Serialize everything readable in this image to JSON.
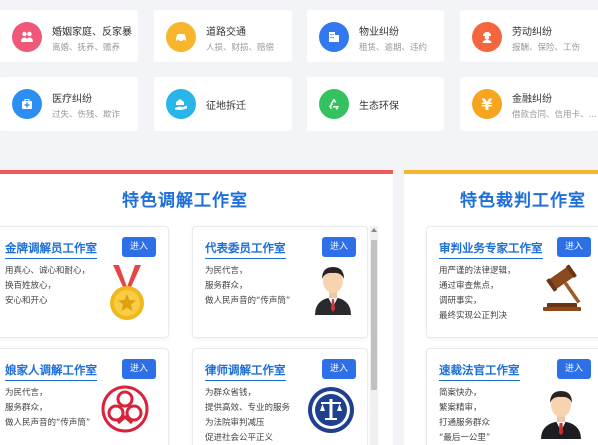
{
  "categories": [
    {
      "title": "婚姻家庭、反家暴",
      "subtitle": "离婚、抚养、赡养",
      "icon": "heart-family-icon",
      "color": "#f0587a"
    },
    {
      "title": "道路交通",
      "subtitle": "人损、财损、赔偿",
      "icon": "car-icon",
      "color": "#f7b52c"
    },
    {
      "title": "物业纠纷",
      "subtitle": "租赁、逾期、违约",
      "icon": "building-icon",
      "color": "#3478f0"
    },
    {
      "title": "劳动纠纷",
      "subtitle": "报酬、保险、工伤",
      "icon": "worker-icon",
      "color": "#f4663e"
    },
    {
      "title": "医疗纠纷",
      "subtitle": "过失、伤残、欺诈",
      "icon": "medical-kit-icon",
      "color": "#2c8ef2"
    },
    {
      "title": "征地拆迁",
      "subtitle": "",
      "icon": "house-hand-icon",
      "color": "#28b6e8"
    },
    {
      "title": "生态环保",
      "subtitle": "",
      "icon": "recycle-icon",
      "color": "#33c25f"
    },
    {
      "title": "金融纠纷",
      "subtitle": "借款合同、信用卡、...",
      "icon": "yen-icon",
      "color": "#f7a51e"
    }
  ],
  "mediation": {
    "title": "特色调解工作室",
    "accent": "#f05a5a",
    "studios": [
      {
        "name": "金牌调解员工作室",
        "button": "进入",
        "lines": [
          "用真心、诚心和耐心，",
          "换百姓放心，",
          "安心和开心"
        ],
        "illustration": "gold-medal-icon"
      },
      {
        "name": "代表委员工作室",
        "button": "进入",
        "lines": [
          "为民代言，",
          "服务群众，",
          "做人民声音的“传声筒”"
        ],
        "illustration": "representative-avatar-icon"
      },
      {
        "name": "娘家人调解工作室",
        "button": "进入",
        "lines": [
          "为民代言，",
          "服务群众，",
          "做人民声音的“传声筒”"
        ],
        "illustration": "women-federation-emblem-icon"
      },
      {
        "name": "律师调解工作室",
        "button": "进入",
        "lines": [
          "为群众省钱，",
          "提供高效、专业的服务",
          "为法院审判减压",
          "促进社会公平正义"
        ],
        "illustration": "lawyers-association-emblem-icon"
      }
    ]
  },
  "adjudication": {
    "title": "特色裁判工作室",
    "accent": "#f7b52c",
    "studios": [
      {
        "name": "审判业务专家工作室",
        "button": "进入",
        "lines": [
          "用严谨的法律逻辑，",
          "通过审查焦点，",
          "调研事实，",
          "最终实现公正判决"
        ],
        "illustration": "gavel-icon"
      },
      {
        "name": "速裁法官工作室",
        "button": "进入",
        "lines": [
          "简案快办，",
          "繁案精审，",
          "打通服务群众",
          "“最后一公里”"
        ],
        "illustration": "judge-avatar-icon"
      }
    ]
  }
}
